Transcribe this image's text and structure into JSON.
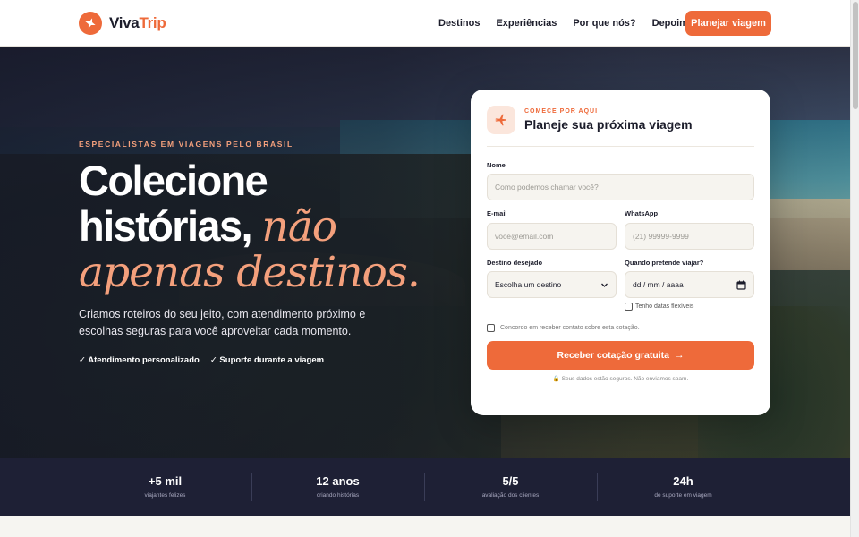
{
  "brand": {
    "name_part1": "Viva",
    "name_part2": "Trip",
    "accent": "#ee6a3a",
    "dark": "#1e2035",
    "peach": "#f4a07c"
  },
  "nav": {
    "links": [
      "Destinos",
      "Experiências",
      "Por que nós?",
      "Depoimentos"
    ],
    "cta": "Planejar viagem"
  },
  "hero": {
    "eyebrow": "ESPECIALISTAS EM VIAGENS PELO BRASIL",
    "headline_line1": "Colecione",
    "headline_line2_plain": "histórias, ",
    "headline_line2_italic": "não",
    "headline_line3_italic": "apenas destinos.",
    "subtitle": "Criamos roteiros do seu jeito, com atendimento próximo e escolhas seguras para você aproveitar cada momento.",
    "checks": [
      "✓ Atendimento personalizado",
      "✓ Suporte durante a viagem"
    ]
  },
  "form": {
    "eyebrow": "COMECE POR AQUI",
    "title": "Planeje sua próxima viagem",
    "name_label": "Nome",
    "name_placeholder": "Como podemos chamar você?",
    "email_label": "E-mail",
    "email_placeholder": "voce@email.com",
    "whatsapp_label": "WhatsApp",
    "whatsapp_placeholder": "(21) 99999-9999",
    "destination_label": "Destino desejado",
    "destination_value": "Escolha um destino",
    "date_label": "Quando pretende viajar?",
    "date_value": "dd / mm / aaaa",
    "flexible_dates": "Tenho datas flexíveis",
    "consent": "Concordo em receber contato sobre esta cotação.",
    "submit": "Receber cotação gratuita",
    "submit_arrow": "→",
    "privacy": "🔒 Seus dados estão seguros. Não enviamos spam."
  },
  "stats": [
    {
      "value": "+5 mil",
      "label": "viajantes felizes"
    },
    {
      "value": "12 anos",
      "label": "criando histórias"
    },
    {
      "value": "5/5",
      "label": "avaliação dos clientes"
    },
    {
      "value": "24h",
      "label": "de suporte em viagem"
    }
  ]
}
